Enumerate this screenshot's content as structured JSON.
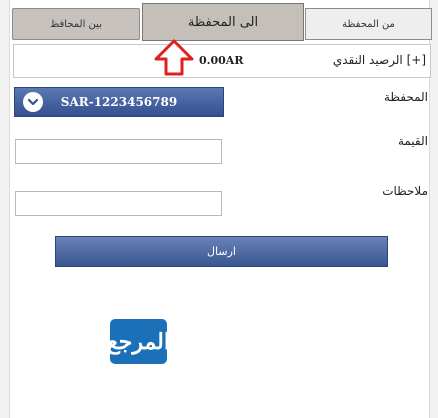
{
  "tabs": {
    "between_wallets": "بين المحافظ",
    "to_wallet": "الى المحفظة",
    "from_wallet": "من المحفظة"
  },
  "balance": {
    "label": "الرصيد النقدي [+]",
    "value": "0.00AR"
  },
  "form": {
    "wallet_label": "المحفظة",
    "wallet_selected": "SAR-1223456789",
    "value_label": "القيمة",
    "value_input": "",
    "notes_label": "ملاحظات",
    "notes_input": "",
    "send_label": "ارسال"
  },
  "logo_text": "المرجع",
  "icons": {
    "arrow": "up-arrow-icon",
    "dropdown": "chevron-down-icon"
  },
  "colors": {
    "accent": "#3a5690",
    "arrow": "#e02020",
    "logo": "#1b70b7",
    "active_tab": "#c5bfba"
  }
}
